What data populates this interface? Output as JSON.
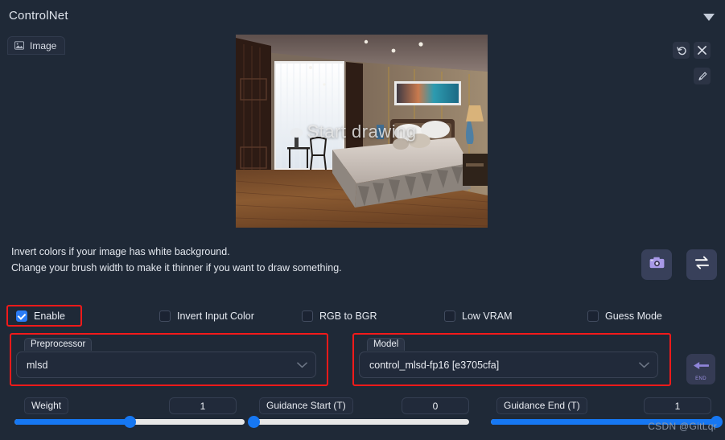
{
  "panel": {
    "title": "ControlNet",
    "collapse_icon": "chevron-down-icon"
  },
  "tab": {
    "label": "Image",
    "icon": "image-icon"
  },
  "preview": {
    "overlay_text": "Start drawing",
    "description": "interior bedroom render"
  },
  "image_tools": [
    {
      "name": "undo-icon",
      "title": "Undo"
    },
    {
      "name": "close-icon",
      "title": "Clear"
    },
    {
      "name": "brush-icon",
      "title": "Brush"
    }
  ],
  "hints": {
    "line1": "Invert colors if your image has white background.",
    "line2": "Change your brush width to make it thinner if you want to draw something."
  },
  "side_buttons": [
    {
      "name": "camera-button",
      "icon": "camera-icon"
    },
    {
      "name": "swap-button",
      "icon": "swap-arrows-icon"
    }
  ],
  "end_button": {
    "label": "END",
    "icon": "arrow-left-icon"
  },
  "checkboxes": [
    {
      "label": "Enable",
      "checked": true
    },
    {
      "label": "Invert Input Color",
      "checked": false
    },
    {
      "label": "RGB to BGR",
      "checked": false
    },
    {
      "label": "Low VRAM",
      "checked": false
    },
    {
      "label": "Guess Mode",
      "checked": false
    }
  ],
  "preprocessor": {
    "label": "Preprocessor",
    "value": "mlsd"
  },
  "model": {
    "label": "Model",
    "value": "control_mlsd-fp16 [e3705cfa]"
  },
  "sliders": [
    {
      "label": "Weight",
      "value": "1",
      "percent": 50
    },
    {
      "label": "Guidance Start (T)",
      "value": "0",
      "percent": 0
    },
    {
      "label": "Guidance End (T)",
      "value": "1",
      "percent": 100
    }
  ],
  "watermark": "CSDN @GitLqr",
  "colors": {
    "background": "#1f2937",
    "accent_blue": "#1677f2",
    "annotation_red": "#f31a1a",
    "text": "#e6eaf1"
  }
}
